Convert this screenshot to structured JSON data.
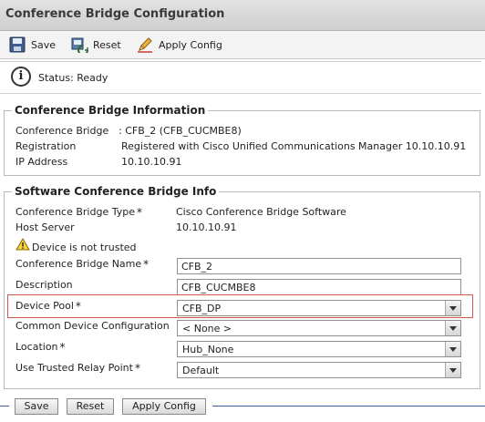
{
  "page": {
    "title": "Conference Bridge Configuration"
  },
  "toolbar": {
    "save_label": "Save",
    "reset_label": "Reset",
    "apply_label": "Apply Config"
  },
  "status": {
    "text": "Status: Ready"
  },
  "info_section": {
    "legend": "Conference Bridge Information",
    "bridge_label": "Conference Bridge",
    "bridge_value": ": CFB_2 (CFB_CUCMBE8)",
    "registration_label": "Registration",
    "registration_value": "Registered with Cisco Unified Communications Manager 10.10.10.91",
    "ip_label": "IP Address",
    "ip_value": "10.10.10.91"
  },
  "software_section": {
    "legend": "Software Conference Bridge Info",
    "type_label": "Conference Bridge Type",
    "type_value": "Cisco Conference Bridge Software",
    "host_label": "Host Server",
    "host_value": "10.10.10.91",
    "warning_text": "Device is not trusted",
    "name_label": "Conference Bridge Name",
    "name_value": "CFB_2",
    "description_label": "Description",
    "description_value": "CFB_CUCMBE8",
    "device_pool_label": "Device Pool",
    "device_pool_value": "CFB_DP",
    "common_config_label": "Common Device Configuration",
    "common_config_value": "< None >",
    "location_label": "Location",
    "location_value": "Hub_None",
    "trusted_relay_label": "Use Trusted Relay Point",
    "trusted_relay_value": "Default",
    "required_marker": "*"
  },
  "bottom_buttons": {
    "save": "Save",
    "reset": "Reset",
    "apply": "Apply Config"
  },
  "icons": {
    "save": "floppy-disk-icon",
    "reset": "reset-icon",
    "apply": "pencil-icon",
    "info": "info-icon",
    "warning": "warning-icon",
    "dropdown": "chevron-down-icon"
  },
  "colors": {
    "highlight": "#d9534f",
    "divider": "#3b5e9a"
  }
}
